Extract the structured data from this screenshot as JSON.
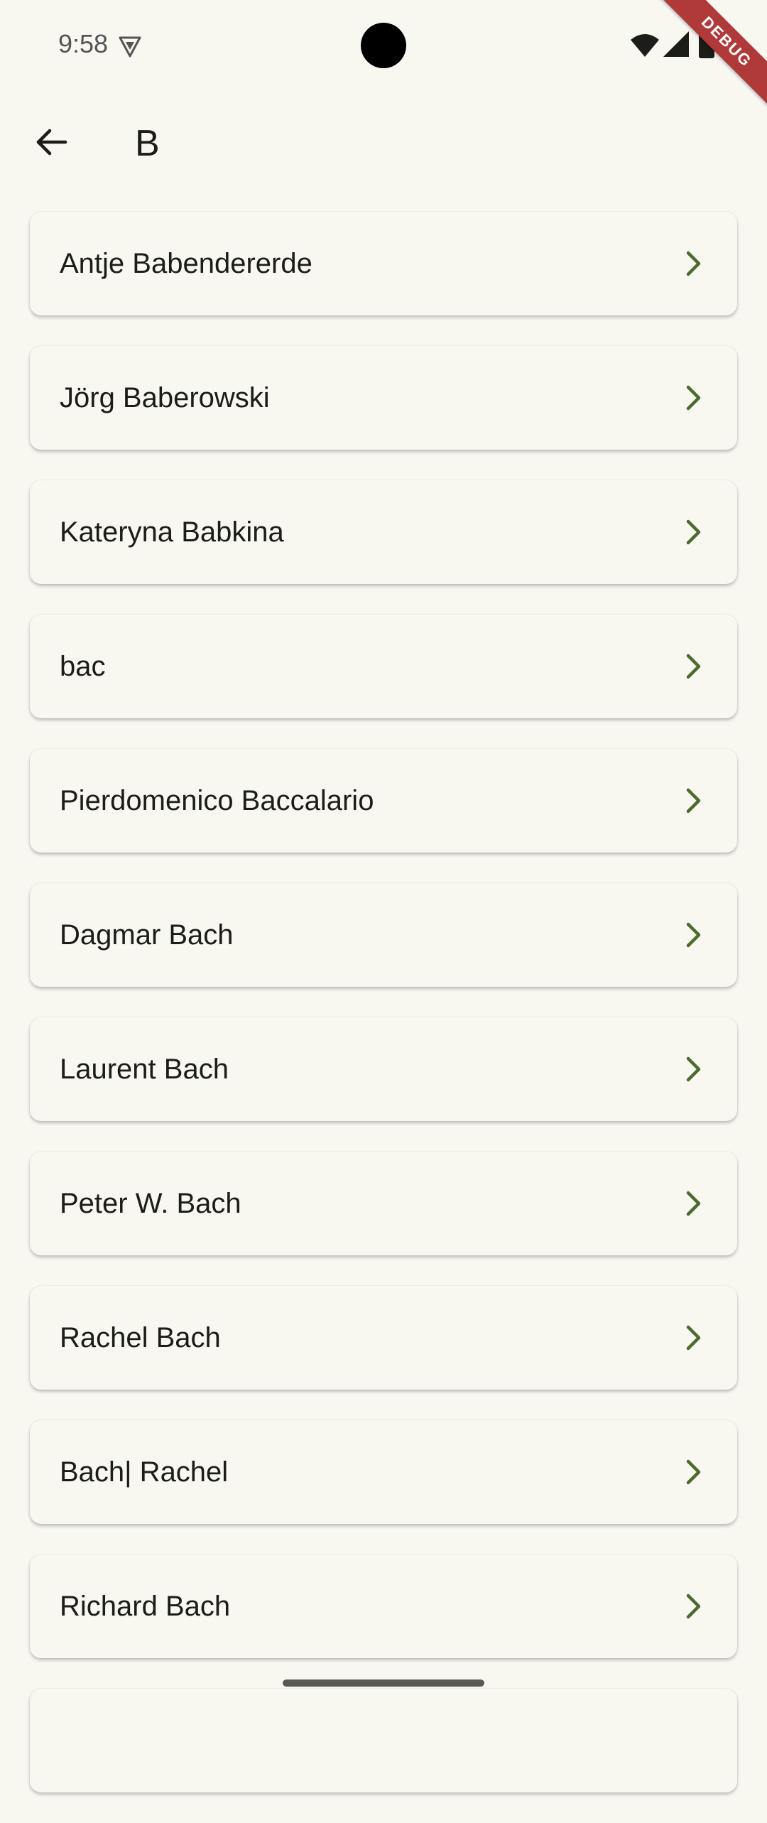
{
  "status_bar": {
    "time": "9:58"
  },
  "debug_banner": "DEBUG",
  "app_bar": {
    "title": "B"
  },
  "colors": {
    "background": "#f8f8f1",
    "chevron": "#4c6b2f",
    "debug_ribbon": "#b03a3a"
  },
  "list": {
    "items": [
      {
        "label": "Antje Babendererde"
      },
      {
        "label": "Jörg Baberowski"
      },
      {
        "label": "Kateryna Babkina"
      },
      {
        "label": "bac"
      },
      {
        "label": "Pierdomenico Baccalario"
      },
      {
        "label": "Dagmar Bach"
      },
      {
        "label": "Laurent Bach"
      },
      {
        "label": "Peter W. Bach"
      },
      {
        "label": "Rachel Bach"
      },
      {
        "label": "Bach| Rachel"
      },
      {
        "label": "Richard Bach"
      }
    ]
  }
}
